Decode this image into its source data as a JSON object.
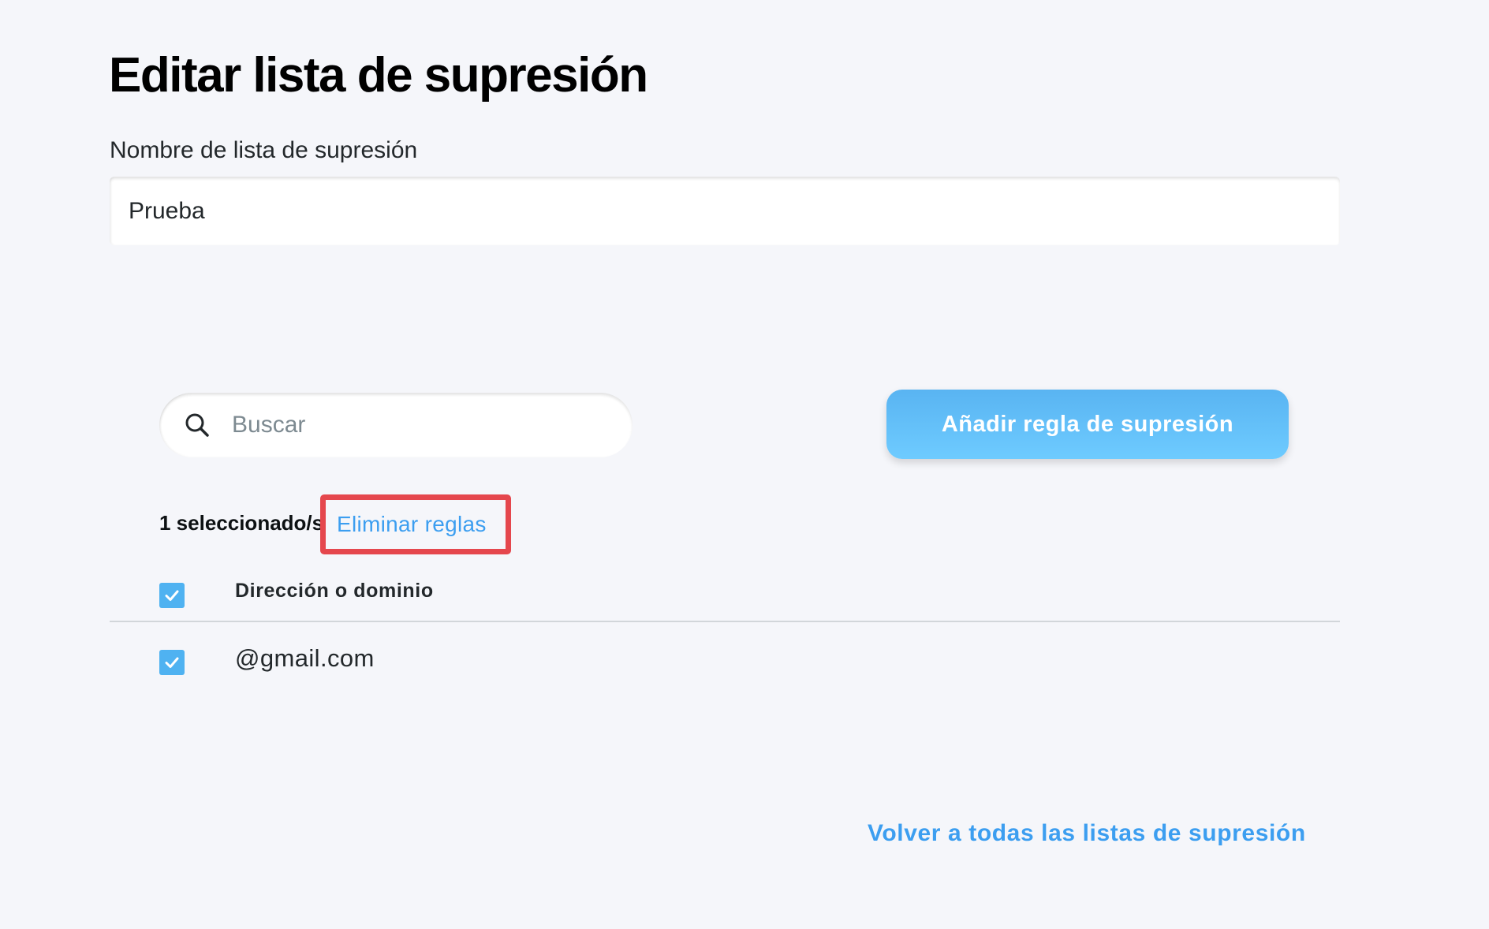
{
  "page": {
    "title": "Editar lista de supresión"
  },
  "form": {
    "name_label": "Nombre de lista de supresión",
    "name_value": "Prueba"
  },
  "toolbar": {
    "search_placeholder": "Buscar",
    "search_icon": "search-icon",
    "add_rule_label": "Añadir regla de supresión"
  },
  "selection": {
    "count_label": "1 seleccionado/s",
    "delete_label": "Eliminar reglas",
    "highlight_color": "#e5474d"
  },
  "table": {
    "columns": [
      {
        "label": "Dirección o dominio"
      }
    ],
    "header_checked": true,
    "rows": [
      {
        "value": "@gmail.com",
        "checked": true
      }
    ]
  },
  "footer": {
    "back_label": "Volver a todas las listas de supresión"
  },
  "colors": {
    "accent": "#3c9ef0",
    "button": "#59b4f2",
    "checkbox": "#4fb2f1",
    "background": "#f5f6fa"
  }
}
